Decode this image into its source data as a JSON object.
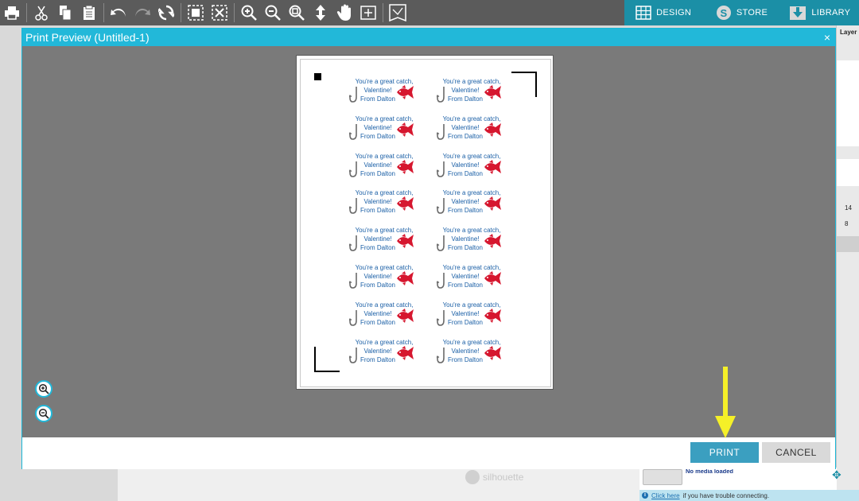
{
  "toolbar": {
    "tools": [
      "print-icon",
      "cut-icon",
      "copy-icon",
      "paste-icon",
      "undo-icon",
      "redo-icon",
      "refresh-icon",
      "select-all-icon",
      "deselect-icon",
      "zoom-in-icon",
      "zoom-out-icon",
      "zoom-fit-icon",
      "move-icon",
      "pan-icon",
      "fit-page-icon",
      "sketch-icon"
    ],
    "tabs": [
      {
        "label": "DESIGN",
        "icon": "grid-icon"
      },
      {
        "label": "STORE",
        "icon": "silhouette-s-icon"
      },
      {
        "label": "LIBRARY",
        "icon": "download-icon"
      }
    ]
  },
  "side_panel": {
    "header": "Layer",
    "value_1": "14",
    "value_2": "8"
  },
  "status": {
    "media": "No media loaded",
    "help_link": "Click here",
    "help_text": "if you have trouble connecting.",
    "watermark": "silhouette"
  },
  "dialog": {
    "title": "Print Preview (Untitled-1)",
    "close": "×",
    "print_label": "PRINT",
    "cancel_label": "CANCEL"
  },
  "preview": {
    "label_text": {
      "line1": "You're a great catch,",
      "line2": "Valentine!",
      "line3": "From Dalton"
    },
    "label_count": 16,
    "text_color": "#1a5fa6",
    "fish_color": "#d6172f"
  },
  "colors": {
    "accent": "#22b8d9",
    "toolbar": "#5b5b5b",
    "print_button": "#3b9fc0",
    "arrow": "#f5f028"
  }
}
